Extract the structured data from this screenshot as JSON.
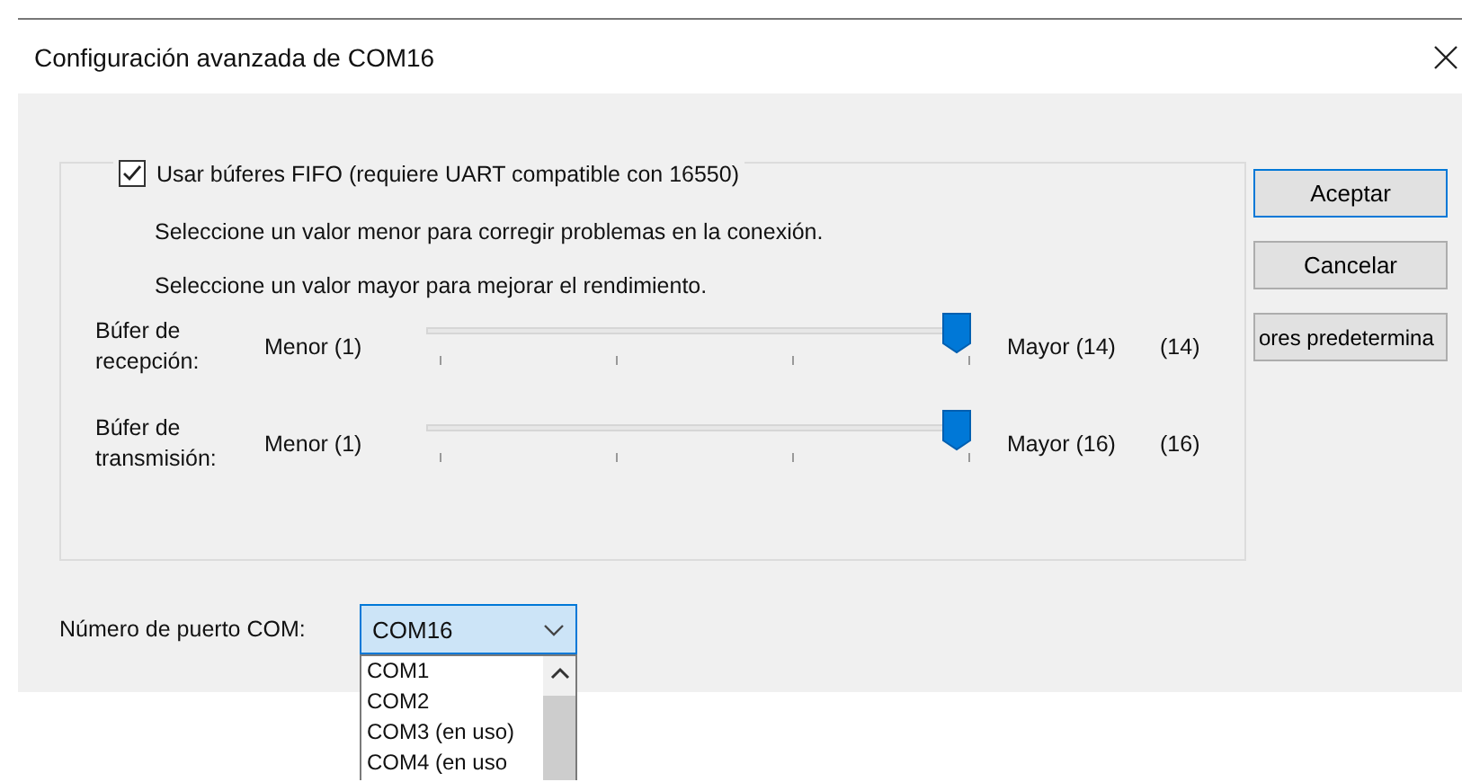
{
  "window": {
    "title": "Configuración avanzada de COM16"
  },
  "fifo": {
    "label": "Usar búferes FIFO (requiere UART compatible con 16550)",
    "checked": true
  },
  "hints": [
    "Seleccione un valor menor para corregir problemas en la conexión.",
    "Seleccione un valor mayor para mejorar el rendimiento."
  ],
  "buffers": [
    {
      "label": "Búfer de recepción:",
      "min_label": "Menor (1)",
      "max_label": "Mayor (14)",
      "level": 1,
      "reading": "(14)"
    },
    {
      "label": "Búfer de transmisión:",
      "min_label": "Menor (1)",
      "max_label": "Mayor (16)",
      "level": 1,
      "reading": "(16)"
    }
  ],
  "buttons": [
    {
      "label": "Aceptar",
      "default": true
    },
    {
      "label": "Cancelar",
      "default": false
    },
    {
      "label": "ores predetermina",
      "default": false
    }
  ],
  "port": {
    "label": "Número de puerto COM:",
    "value": "COM16",
    "options": [
      {
        "label": "COM1"
      },
      {
        "label": "COM2"
      },
      {
        "label": "COM3 (en uso)"
      },
      {
        "label": "COM4 (en uso"
      }
    ]
  }
}
